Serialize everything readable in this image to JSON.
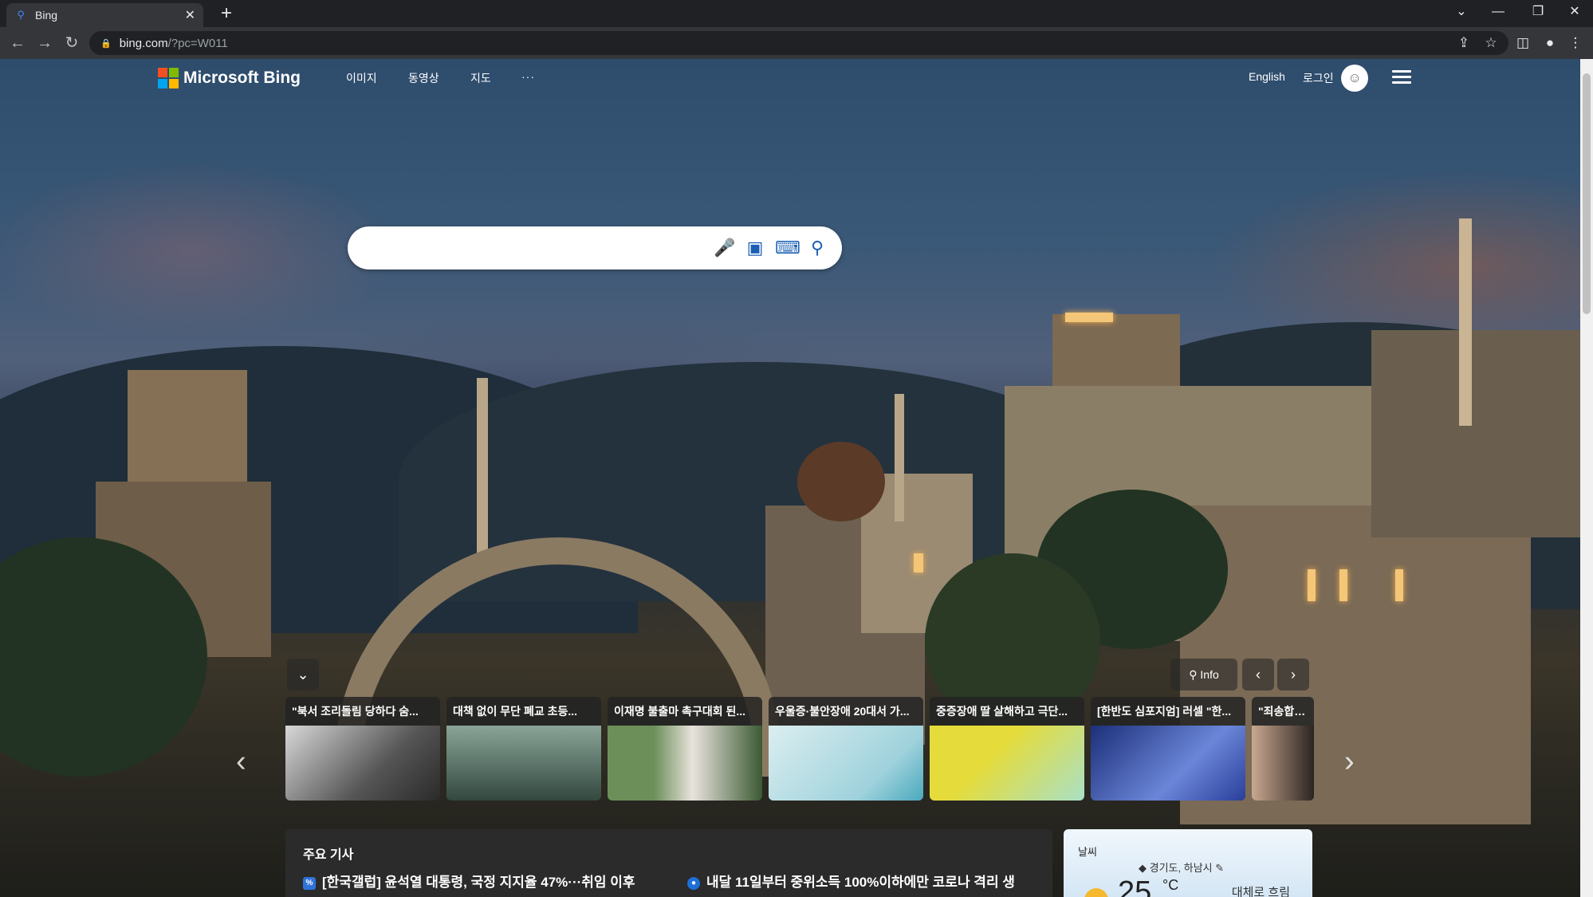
{
  "browser": {
    "tab_title": "Bing",
    "tab_favicon": "bing-search-icon",
    "url_host": "bing.com",
    "url_path": "/?pc=W011"
  },
  "header": {
    "logo_text": "Microsoft Bing",
    "nav_items": [
      "이미지",
      "동영상",
      "지도",
      "···"
    ],
    "language": "English",
    "login": "로그인"
  },
  "search": {
    "placeholder": "",
    "value": ""
  },
  "carousel": {
    "info_label": "Info",
    "cards": [
      {
        "title": "\"북서 조리돌림 당하다 숨...",
        "img_colors": [
          "#d8d8d8",
          "#2a2a2a"
        ]
      },
      {
        "title": "대책 없이 무단 폐교 초등...",
        "img_colors": [
          "#8aa598",
          "#33483f"
        ]
      },
      {
        "title": "이재명 불출마 촉구대회 된...",
        "img_colors": [
          "#6c8f5a",
          "#e8e3dc"
        ]
      },
      {
        "title": "우울증·불안장애 20대서 가...",
        "img_colors": [
          "#dbeef0",
          "#4aa9bd"
        ]
      },
      {
        "title": "중증장애 딸 살해하고 극단...",
        "img_colors": [
          "#e5dc3b",
          "#a9e0c6"
        ]
      },
      {
        "title": "[한반도 심포지엄] 러셀 \"한...",
        "img_colors": [
          "#1c2f7a",
          "#6b86d8"
        ]
      },
      {
        "title": "\"죄송합니다",
        "img_colors": [
          "#c9a890",
          "#2a2420"
        ]
      }
    ]
  },
  "top_news": {
    "title": "주요 기사",
    "items": [
      {
        "badge": "%",
        "text": "[한국갤럽] 윤석열 대통령, 국정 지지율 47%···취임 이후"
      },
      {
        "badge": "●",
        "text": "내달 11일부터 중위소득 100%이하에만 코로나 격리 생"
      }
    ]
  },
  "weather": {
    "label": "날씨",
    "location": "경기도, 하남시",
    "temp": "25",
    "unit": "°C",
    "condition": "대체로 흐림"
  }
}
